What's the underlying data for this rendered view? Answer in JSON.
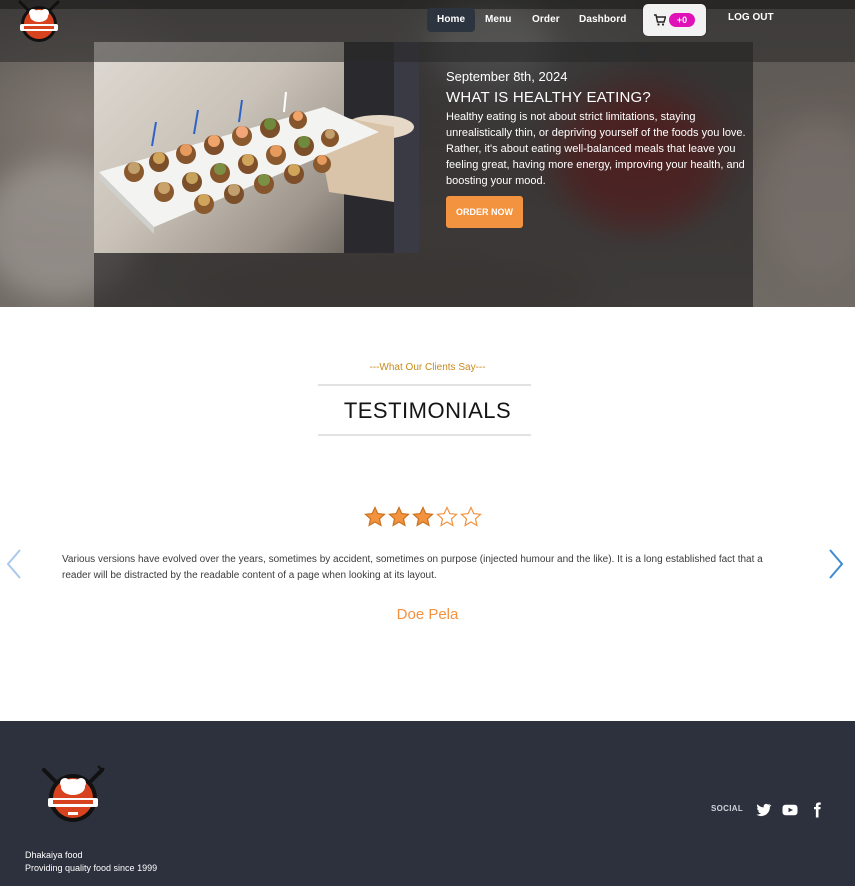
{
  "nav": {
    "items": [
      "Home",
      "Menu",
      "Order",
      "Dashbord"
    ],
    "cart_count": "+0",
    "logout": "LOG OUT"
  },
  "hero": {
    "date": "September 8th, 2024",
    "title": "WHAT IS HEALTHY EATING?",
    "text": "Healthy eating is not about strict limitations, staying unrealistically thin, or depriving yourself of the foods you love. Rather, it's about eating well-balanced meals that leave you feeling great, having more energy, improving your health, and boosting your mood.",
    "cta": "ORDER NOW"
  },
  "testimonials": {
    "subheading": "---What Our Clients Say---",
    "heading": "TESTIMONIALS",
    "rating": 3,
    "rating_max": 5,
    "quote": "Various versions have evolved over the years, sometimes by accident, sometimes on purpose (injected humour and the like). It is a long established fact that a reader will be distracted by the readable content of a page when looking at its layout.",
    "author": "Doe Pela"
  },
  "footer": {
    "name": "Dhakaiya food",
    "tagline": "Providing quality food since 1999",
    "social_label": "SOCIAL",
    "social_icons": [
      "twitter-icon",
      "youtube-icon",
      "facebook-icon"
    ]
  },
  "colors": {
    "accent": "#f3923f",
    "badge": "#e011b9",
    "footer_bg": "#2c313d",
    "nav_active": "#2c3440",
    "arrow": "#3b8bd6"
  }
}
